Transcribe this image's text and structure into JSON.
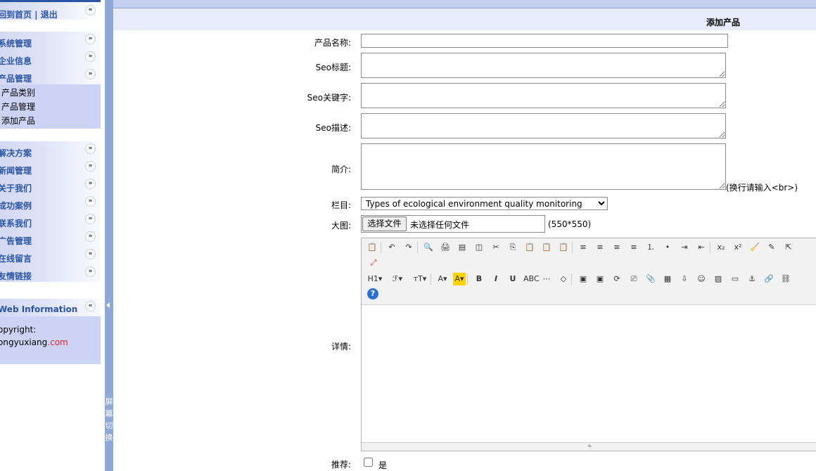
{
  "sidebar": {
    "home_logout": "回到首页 | 退出",
    "groups": [
      {
        "label": "系统管理"
      },
      {
        "label": "企业信息"
      },
      {
        "label": "产品管理"
      }
    ],
    "product_sub": [
      "产品类别",
      "产品管理",
      "添加产品"
    ],
    "groups2": [
      {
        "label": "解决方案"
      },
      {
        "label": "新闻管理"
      },
      {
        "label": "关于我们"
      },
      {
        "label": "成功案例"
      },
      {
        "label": "联系我们"
      },
      {
        "label": "广告管理"
      },
      {
        "label": "在线留言"
      },
      {
        "label": "友情链接"
      }
    ],
    "web_info": {
      "title": "Web Information",
      "copyright": "opyright:",
      "domain_a": "ongyuxiang",
      "domain_b": ".com"
    },
    "collapse_glyph": "«",
    "expand_glyph": "»"
  },
  "splitter": {
    "label_chars": [
      "屏",
      "幕",
      "切",
      "换"
    ]
  },
  "page": {
    "title": "添加产品"
  },
  "form": {
    "name_label": "产品名称:",
    "seo_title_label": "Seo标题:",
    "seo_keywords_label": "Seo关键字:",
    "seo_desc_label": "Seo描述:",
    "intro_label": "简介:",
    "intro_note": "(换行请输入<br>)",
    "column_label": "栏目:",
    "column_value": "Types of ecological environment quality monitoring",
    "image_label": "大图:",
    "file_button": "选择文件",
    "file_status": "未选择任何文件",
    "image_size": "(550*550)",
    "details_label": "详情:",
    "recommend_label": "推荐:",
    "recommend_option": "是"
  },
  "editor": {
    "row1": [
      "📋",
      "↶",
      "↷",
      "🔍",
      "🖨",
      "▤",
      "◫",
      "✂",
      "⎘",
      "📋",
      "📋",
      "📋",
      "≡",
      "≡",
      "≡",
      "≡",
      "⒈",
      "•",
      "⇥",
      "⇤",
      "x₂",
      "x²",
      "🧹",
      "✎",
      "⇱"
    ],
    "row1b": [
      "⤢"
    ],
    "row2": [
      "H1▾",
      "ℱ▾",
      "тT▾",
      "A▾",
      "A▾",
      "B",
      "I",
      "U",
      "ABC",
      "⋯",
      "◇",
      "▣",
      "▣",
      "⟳",
      "⎚",
      "📎",
      "▦",
      "⇩",
      "☺",
      "▨",
      "▭",
      "⚓",
      "🔗",
      "⛓"
    ],
    "help": "?",
    "resize": "÷"
  },
  "colors": {
    "accent": "#2a55a5",
    "sidebar_bg": "#ccd3f4",
    "splitter": "#8ea9d9",
    "domain_highlight": "#e0242a"
  }
}
